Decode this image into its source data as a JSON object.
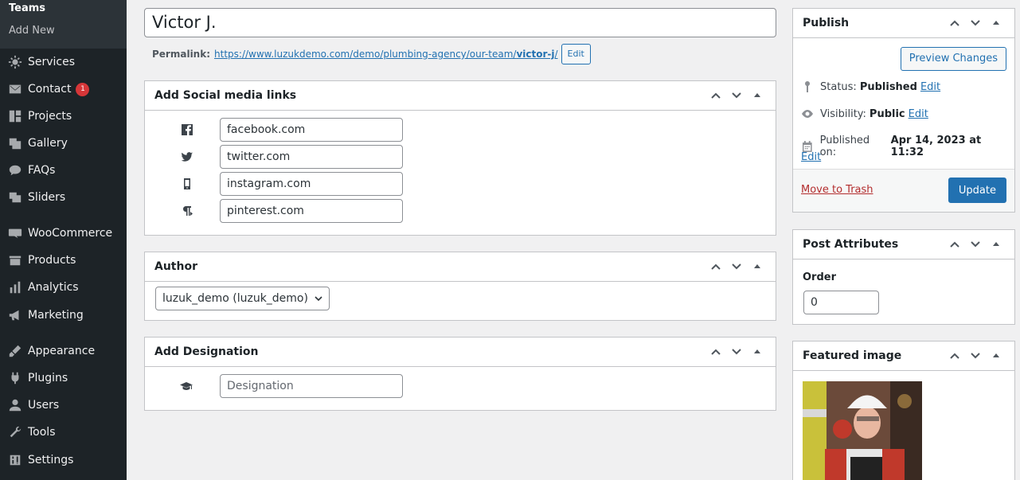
{
  "sidebar": {
    "submenu": {
      "current": "Teams",
      "add_new": "Add New"
    },
    "items": [
      {
        "label": "Services",
        "icon": "services-icon"
      },
      {
        "label": "Contact",
        "icon": "mail-icon",
        "badge": "1"
      },
      {
        "label": "Projects",
        "icon": "projects-icon"
      },
      {
        "label": "Gallery",
        "icon": "gallery-icon"
      },
      {
        "label": "FAQs",
        "icon": "faq-icon"
      },
      {
        "label": "Sliders",
        "icon": "sliders-icon"
      },
      {
        "label": "WooCommerce",
        "icon": "woocommerce-icon"
      },
      {
        "label": "Products",
        "icon": "products-icon"
      },
      {
        "label": "Analytics",
        "icon": "analytics-icon"
      },
      {
        "label": "Marketing",
        "icon": "marketing-icon"
      },
      {
        "label": "Appearance",
        "icon": "appearance-icon"
      },
      {
        "label": "Plugins",
        "icon": "plugins-icon"
      },
      {
        "label": "Users",
        "icon": "users-icon"
      },
      {
        "label": "Tools",
        "icon": "tools-icon"
      },
      {
        "label": "Settings",
        "icon": "settings-icon"
      }
    ]
  },
  "post": {
    "title": "Victor J.",
    "permalink_label": "Permalink:",
    "permalink_base": "https://www.luzukdemo.com/demo/plumbing-agency/our-team/",
    "permalink_slug": "victor-j",
    "permalink_trail": "/",
    "permalink_edit": "Edit"
  },
  "social_box": {
    "title": "Add Social media links",
    "fields": [
      {
        "value": "facebook.com",
        "icon": "facebook-icon"
      },
      {
        "value": "twitter.com",
        "icon": "twitter-icon"
      },
      {
        "value": "instagram.com",
        "icon": "instagram-icon"
      },
      {
        "value": "pinterest.com",
        "icon": "pinterest-icon"
      }
    ]
  },
  "author_box": {
    "title": "Author",
    "selected": "luzuk_demo (luzuk_demo)"
  },
  "designation_box": {
    "title": "Add Designation",
    "placeholder": "Designation",
    "icon": "graduation-cap-icon"
  },
  "publish": {
    "title": "Publish",
    "preview": "Preview Changes",
    "status_label": "Status:",
    "status_value": "Published",
    "visibility_label": "Visibility:",
    "visibility_value": "Public",
    "published_label": "Published on:",
    "published_value": "Apr 14, 2023 at 11:32",
    "edit": "Edit",
    "trash": "Move to Trash",
    "update": "Update"
  },
  "post_attributes": {
    "title": "Post Attributes",
    "order_label": "Order",
    "order_value": "0"
  },
  "featured_image": {
    "title": "Featured image"
  }
}
